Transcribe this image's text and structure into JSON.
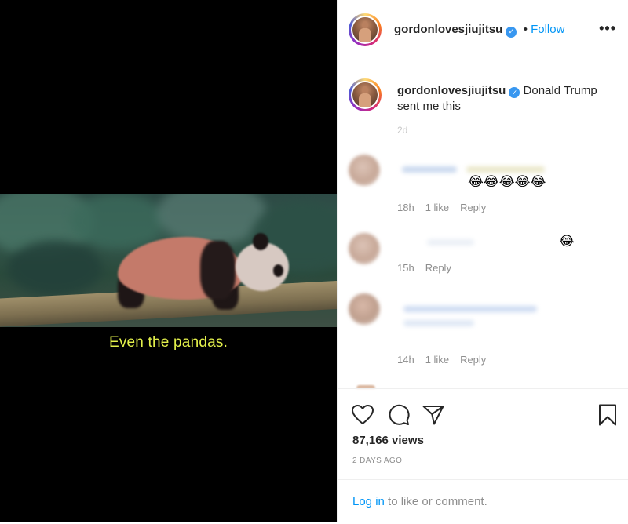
{
  "video": {
    "subtitle": "Even the pandas."
  },
  "header": {
    "username": "gordonlovesjiujitsu",
    "separator": "•",
    "follow_label": "Follow",
    "more_label": "•••"
  },
  "caption": {
    "username": "gordonlovesjiujitsu",
    "text": "Donald Trump sent me this",
    "time": "2d"
  },
  "comments": [
    {
      "emoji": "😂😂😂😂😂",
      "time": "18h",
      "likes": "1 like",
      "reply": "Reply"
    },
    {
      "emoji": "😂",
      "time": "15h",
      "reply": "Reply"
    },
    {
      "time": "14h",
      "likes": "1 like",
      "reply": "Reply"
    }
  ],
  "footer": {
    "icons": [
      "heart-icon",
      "comment-icon",
      "share-icon",
      "bookmark-icon"
    ],
    "views": "87,166 views",
    "posted": "2 DAYS AGO",
    "login_link": "Log in",
    "login_rest": " to like or comment."
  },
  "colors": {
    "accent": "#0095f6",
    "verified": "#3897f0",
    "subtitle": "#e3f04b",
    "text": "#262626",
    "muted": "#8e8e8e"
  }
}
